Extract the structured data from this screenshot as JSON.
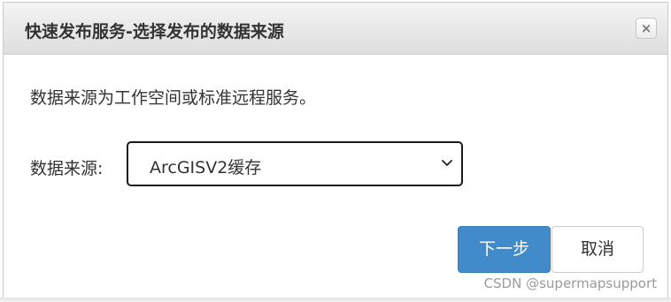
{
  "dialog": {
    "title": "快速发布服务-选择发布的数据来源",
    "close_label": "×",
    "description": "数据来源为工作空间或标准远程服务。",
    "source_label": "数据来源:",
    "source_select": {
      "selected_value": "ArcGISV2缓存"
    },
    "next_button_label": "下一步",
    "cancel_button_label": "取消",
    "colors": {
      "primary_button": "#428bca",
      "title_bar": "#e6e6e6"
    }
  },
  "watermark": "CSDN @supermapsupport"
}
